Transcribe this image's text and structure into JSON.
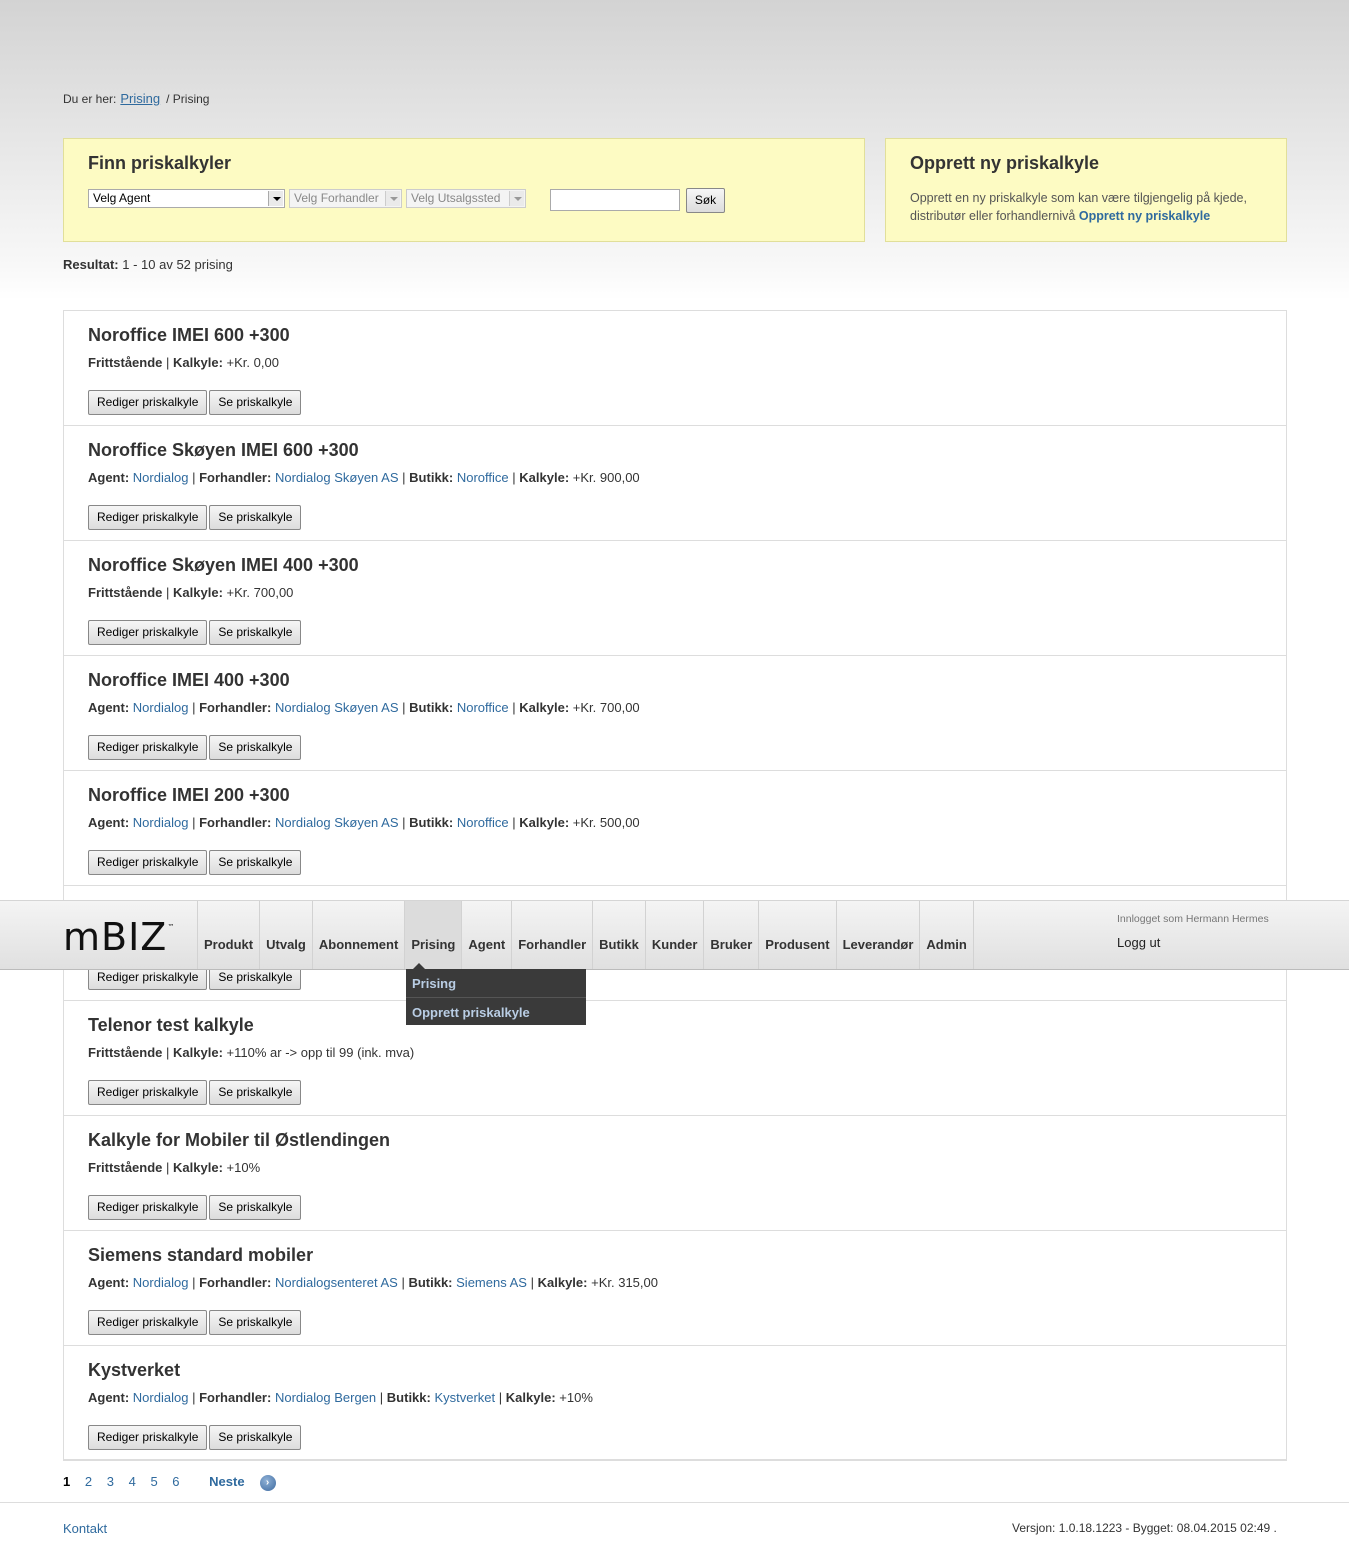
{
  "breadcrumb": {
    "prefix": "Du er her:",
    "link": "Prising",
    "current": "/ Prising"
  },
  "find": {
    "title": "Finn priskalkyler",
    "agent_select": "Velg Agent",
    "forhandler_select": "Velg Forhandler",
    "utsalgssted_select": "Velg Utsalgssted",
    "search_value": "",
    "search_button": "Søk"
  },
  "create": {
    "title": "Opprett ny priskalkyle",
    "description": "Opprett en ny priskalkyle som kan være tilgjengelig på kjede, distributør eller forhandlernivå",
    "link": "Opprett ny priskalkyle"
  },
  "result": {
    "label": "Resultat:",
    "text": "1 - 10 av 52 prising"
  },
  "labels": {
    "frittstaende": "Frittstående",
    "kalkyle": "Kalkyle:",
    "agent": "Agent:",
    "forhandler": "Forhandler:",
    "butikk": "Butikk:",
    "sep": "|"
  },
  "buttons": {
    "edit": "Rediger priskalkyle",
    "view": "Se priskalkyle"
  },
  "items": [
    {
      "title": "Noroffice IMEI 600 +300",
      "kalkyle": "+Kr. 0,00"
    },
    {
      "title": "Noroffice Skøyen IMEI 600 +300",
      "agent": "Nordialog",
      "forhandler": "Nordialog Skøyen AS",
      "butikk": "Noroffice",
      "kalkyle": "+Kr. 900,00"
    },
    {
      "title": "Noroffice Skøyen IMEI 400 +300",
      "kalkyle": "+Kr. 700,00"
    },
    {
      "title": "Noroffice IMEI 400 +300",
      "agent": "Nordialog",
      "forhandler": "Nordialog Skøyen AS",
      "butikk": "Noroffice",
      "kalkyle": "+Kr. 700,00"
    },
    {
      "title": "Noroffice IMEI 200 +300",
      "agent": "Nordialog",
      "forhandler": "Nordialog Skøyen AS",
      "butikk": "Noroffice",
      "kalkyle": "+Kr. 500,00"
    },
    {
      "title": "",
      "kalkyle": ""
    },
    {
      "title": "Telenor test kalkyle",
      "kalkyle": "+110% ar -> opp til 99 (ink. mva)"
    },
    {
      "title": "Kalkyle for Mobiler til Østlendingen",
      "kalkyle": "+10%"
    },
    {
      "title": "Siemens standard mobiler",
      "agent": "Nordialog",
      "forhandler": "Nordialogsenteret AS",
      "butikk": "Siemens AS",
      "kalkyle": "+Kr. 315,00"
    },
    {
      "title": "Kystverket",
      "agent": "Nordialog",
      "forhandler": "Nordialog Bergen",
      "butikk": "Kystverket",
      "kalkyle": "+10%"
    }
  ],
  "pager": {
    "pages": [
      "1",
      "2",
      "3",
      "4",
      "5",
      "6"
    ],
    "current": "1",
    "next": "Neste"
  },
  "footer": {
    "contact": "Kontakt",
    "version": "Versjon: 1.0.18.1223 - Bygget: 08.04.2015 02:49 ."
  },
  "navbar": {
    "logo": "mBIZ",
    "logo_tm": "™",
    "items": [
      "Produkt",
      "Utvalg",
      "Abonnement",
      "Prising",
      "Agent",
      "Forhandler",
      "Butikk",
      "Kunder",
      "Bruker",
      "Produsent",
      "Leverandør",
      "Admin"
    ],
    "active": "Prising",
    "user": "Innlogget som Hermann Hermes",
    "logout": "Logg ut"
  },
  "dropdown": {
    "items": [
      "Prising",
      "Opprett priskalkyle"
    ]
  }
}
